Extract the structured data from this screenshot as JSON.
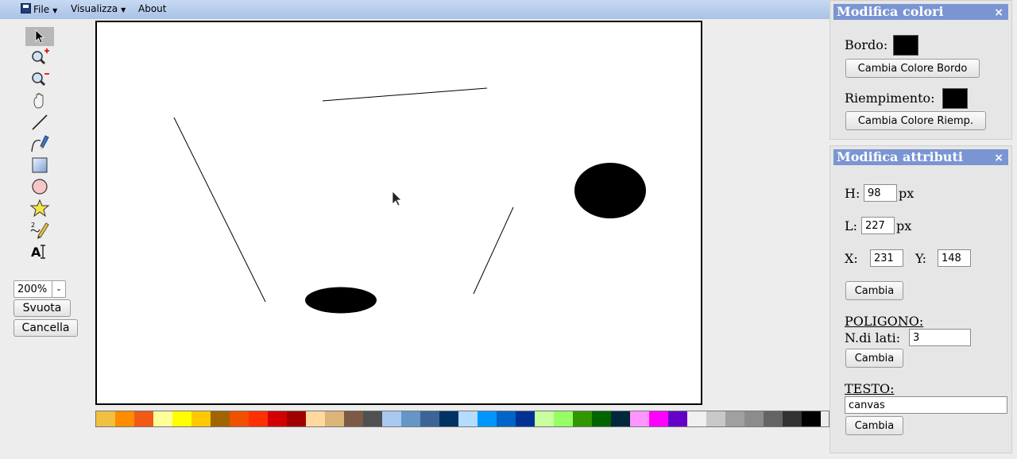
{
  "menu": {
    "file_label": "File",
    "view_label": "Visualizza",
    "about_label": "About"
  },
  "tools": [
    {
      "name": "select-tool",
      "icon": "arrow-cursor-icon",
      "active": true
    },
    {
      "name": "zoom-in-tool",
      "icon": "zoom-in-icon"
    },
    {
      "name": "zoom-out-tool",
      "icon": "zoom-out-icon"
    },
    {
      "name": "pan-tool",
      "icon": "hand-icon"
    },
    {
      "name": "line-tool",
      "icon": "line-icon"
    },
    {
      "name": "polyline-tool",
      "icon": "pen-curve-icon"
    },
    {
      "name": "rectangle-tool",
      "icon": "rectangle-icon"
    },
    {
      "name": "ellipse-tool",
      "icon": "circle-icon"
    },
    {
      "name": "polygon-tool",
      "icon": "star-icon"
    },
    {
      "name": "freehand-tool",
      "icon": "pencil-icon"
    },
    {
      "name": "text-tool",
      "icon": "text-icon"
    }
  ],
  "left": {
    "zoom_value": "200%",
    "clear_label": "Svuota",
    "delete_label": "Cancella"
  },
  "palette": [
    "#f0c040",
    "#ff8c00",
    "#f05a14",
    "#ffff99",
    "#ffff00",
    "#ffc800",
    "#a06400",
    "#f05000",
    "#ff3000",
    "#d20000",
    "#a00000",
    "#ffd9a0",
    "#dcb478",
    "#7d5a46",
    "#505050",
    "#a8c8f0",
    "#6496c8",
    "#3c6496",
    "#003264",
    "#b4dcff",
    "#0096ff",
    "#0064c8",
    "#003296",
    "#c8ffa0",
    "#96ff64",
    "#329600",
    "#006400",
    "#00283c",
    "#ff96ff",
    "#ff00ff",
    "#6400c8",
    "#f0f0f0",
    "#c8c8c8",
    "#a0a0a0",
    "#8c8c8c",
    "#646464",
    "#323232",
    "#000000"
  ],
  "colors_panel": {
    "title": "Modifica colori",
    "close": "×",
    "border_label": "Bordo:",
    "border_color": "#000000",
    "change_border_label": "Cambia Colore Bordo",
    "fill_label": "Riempimento:",
    "fill_color": "#000000",
    "change_fill_label": "Cambia Colore Riemp."
  },
  "attrs_panel": {
    "title": "Modifica attributi",
    "close": "×",
    "h_label": "H:",
    "h_value": "98",
    "h_unit": "px",
    "l_label": "L:",
    "l_value": "227",
    "l_unit": "px",
    "x_label": "X:",
    "x_value": "231",
    "y_label": "Y:",
    "y_value": "148",
    "change_label": "Cambia",
    "polygon_heading": "POLIGONO:",
    "sides_label": "N.di lati:",
    "sides_value": "3",
    "polygon_change_label": "Cambia",
    "text_heading": "TESTO:",
    "text_value": "canvas",
    "text_change_label": "Cambia"
  }
}
